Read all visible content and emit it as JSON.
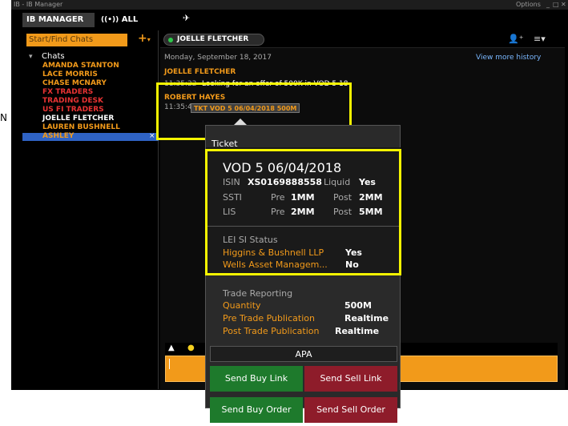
{
  "window": {
    "title": "IB - IB Manager",
    "options_label": "Options"
  },
  "tabs": [
    {
      "label": "IB MANAGER"
    },
    {
      "label": "ALL CHATS"
    }
  ],
  "left_fragment": "N",
  "sidebar": {
    "search_placeholder": "Start/Find Chats",
    "add_label": "+",
    "group_label": "Chats",
    "items": [
      {
        "label": "AMANDA STANTON",
        "color": "#f29a1a"
      },
      {
        "label": "LACE MORRIS",
        "color": "#f29a1a"
      },
      {
        "label": "CHASE MCNARY",
        "color": "#f29a1a"
      },
      {
        "label": "FX TRADERS",
        "color": "#e83333"
      },
      {
        "label": "TRADING DESK",
        "color": "#e83333"
      },
      {
        "label": "US FI TRADERS",
        "color": "#e83333"
      },
      {
        "label": "JOELLE FLETCHER",
        "color": "#ffffff"
      },
      {
        "label": "LAUREN BUSHNELL",
        "color": "#f29a1a"
      },
      {
        "label": "ASHLEY",
        "color": "#f29a1a"
      }
    ],
    "selected_close": "×"
  },
  "chat": {
    "tag_label": "JOELLE FLETCHER",
    "date": "Monday, September 18, 2017",
    "history_link": "View more history",
    "messages": [
      {
        "sender": "JOELLE FLETCHER",
        "time": "11:35:22",
        "text": "Looking for an offer of 500K in VOD 5 18"
      },
      {
        "sender": "ROBERT HAYES",
        "time": "11:35:44",
        "text": "TKT VOD 5 06/04/2018 500M"
      }
    ]
  },
  "ticket": {
    "header": "Ticket",
    "bond": "VOD 5 06/04/2018",
    "isin_label": "ISIN",
    "isin": "XS0169888558",
    "liquid_label": "Liquid",
    "liquid": "Yes",
    "ssti_label": "SSTI",
    "ssti_pre_label": "Pre",
    "ssti_pre": "1MM",
    "ssti_post_label": "Post",
    "ssti_post": "2MM",
    "lis_label": "LIS",
    "lis_pre_label": "Pre",
    "lis_pre": "2MM",
    "lis_post_label": "Post",
    "lis_post": "5MM",
    "lei_header": "LEI SI Status",
    "lei": [
      {
        "name": "Higgins & Bushnell LLP",
        "value": "Yes"
      },
      {
        "name": "Wells Asset Managem...",
        "value": "No"
      }
    ],
    "tr_header": "Trade Reporting",
    "tr": [
      {
        "name": "Quantity",
        "value": "500M"
      },
      {
        "name": "Pre Trade Publication",
        "value": "Realtime"
      },
      {
        "name": "Post Trade Publication",
        "value": "Realtime"
      }
    ],
    "apa_label": "APA",
    "buttons": {
      "buy_link": "Send Buy Link",
      "sell_link": "Send Sell Link",
      "buy_order": "Send Buy Order",
      "sell_order": "Send Sell Order"
    }
  },
  "colors": {
    "accent": "#f29a1a",
    "highlight": "#f5f500",
    "buy": "#1e7a2c",
    "sell": "#8e1c2a"
  }
}
